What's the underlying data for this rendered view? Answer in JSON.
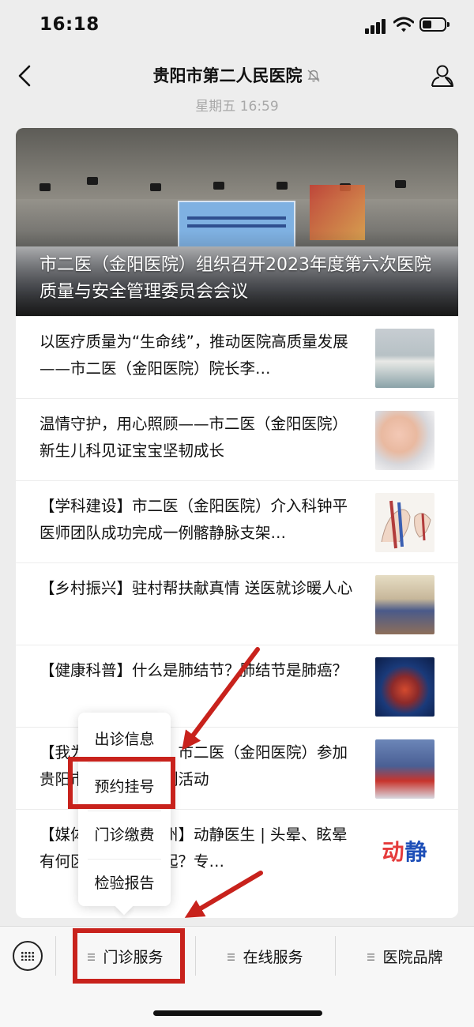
{
  "status_bar": {
    "time": "16:18"
  },
  "nav": {
    "title": "贵阳市第二人民医院"
  },
  "timestamp": "星期五 16:59",
  "hero": {
    "caption": "市二医（金阳医院）组织召开2023年度第六次医院质量与安全管理委员会会议"
  },
  "articles": [
    {
      "title": "以医疗质量为“生命线”，推动医院高质量发展——市二医（金阳医院）院长李…"
    },
    {
      "title": "温情守护，用心照顾——市二医（金阳医院）新生儿科见证宝宝坚韧成长"
    },
    {
      "title": "【学科建设】市二医（金阳医院）介入科钟平医师团队成功完成一例髂静脉支架…"
    },
    {
      "title": "【乡村振兴】驻村帮扶献真情 送医就诊暖人心"
    },
    {
      "title": "【健康科普】什么是肺结节？肺结节是肺癌？"
    },
    {
      "title": "【我为群众办实事】市二医（金阳医院）参加贵阳市卫生技节系列活动"
    },
    {
      "title": "【媒体看医院@贵州】动静医生 | 头晕、眩晕有何区别？怎么引起？专…"
    }
  ],
  "thumb_logo": {
    "part1": "动",
    "part2": "静"
  },
  "popup_menu": [
    {
      "label": "出诊信息"
    },
    {
      "label": "预约挂号"
    },
    {
      "label": "门诊缴费"
    },
    {
      "label": "检验报告"
    }
  ],
  "bottom_tabs": [
    {
      "label": "门诊服务"
    },
    {
      "label": "在线服务"
    },
    {
      "label": "医院品牌"
    }
  ],
  "colors": {
    "annotation_red": "#c8221c",
    "background": "#ededed"
  },
  "icons": [
    "back-chevron-icon",
    "mute-bell-icon",
    "profile-icon",
    "keyboard-icon",
    "menu-lines-icon",
    "signal-icon",
    "wifi-icon",
    "battery-icon"
  ]
}
